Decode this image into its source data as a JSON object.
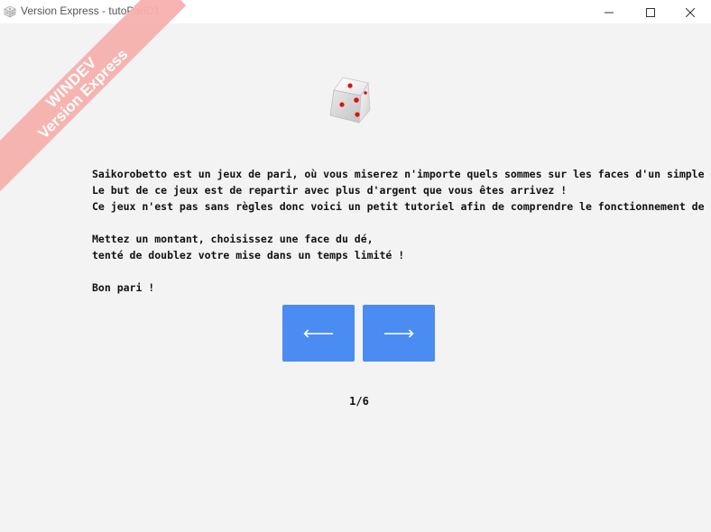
{
  "window": {
    "title": "Version Express - tutoPariD1",
    "app_icon": "dice-icon",
    "controls": {
      "minimize_icon": "minimize-icon",
      "maximize_icon": "maximize-icon",
      "close_icon": "close-icon"
    }
  },
  "watermark": {
    "line1": "WINDEV",
    "line2": "Version Express",
    "color": "#f7b1ae"
  },
  "illustration": {
    "icon": "dice-icon",
    "pip_color": "#e01010"
  },
  "tutorial": {
    "paragraph1": [
      "Saikorobetto est un jeux de pari, où vous miserez n'importe quels sommes sur les faces d'un simple dé !",
      "Le but de ce jeux est de repartir avec plus d'argent que vous êtes arrivez !",
      "Ce jeux n'est pas sans règles donc voici un petit tutoriel afin de comprendre le fonctionnement de ce jeux."
    ],
    "paragraph2": [
      "Mettez un montant, choisissez une face du dé,",
      "tenté de doublez votre mise dans un temps limité !"
    ],
    "paragraph3": [
      "Bon pari !"
    ]
  },
  "navigation": {
    "prev_label": "🡐",
    "next_label": "🡒",
    "prev_icon": "arrow-left-icon",
    "next_icon": "arrow-right-icon",
    "button_color": "#4a8cf2"
  },
  "pager": {
    "text": "1/6",
    "current": 1,
    "total": 6
  }
}
